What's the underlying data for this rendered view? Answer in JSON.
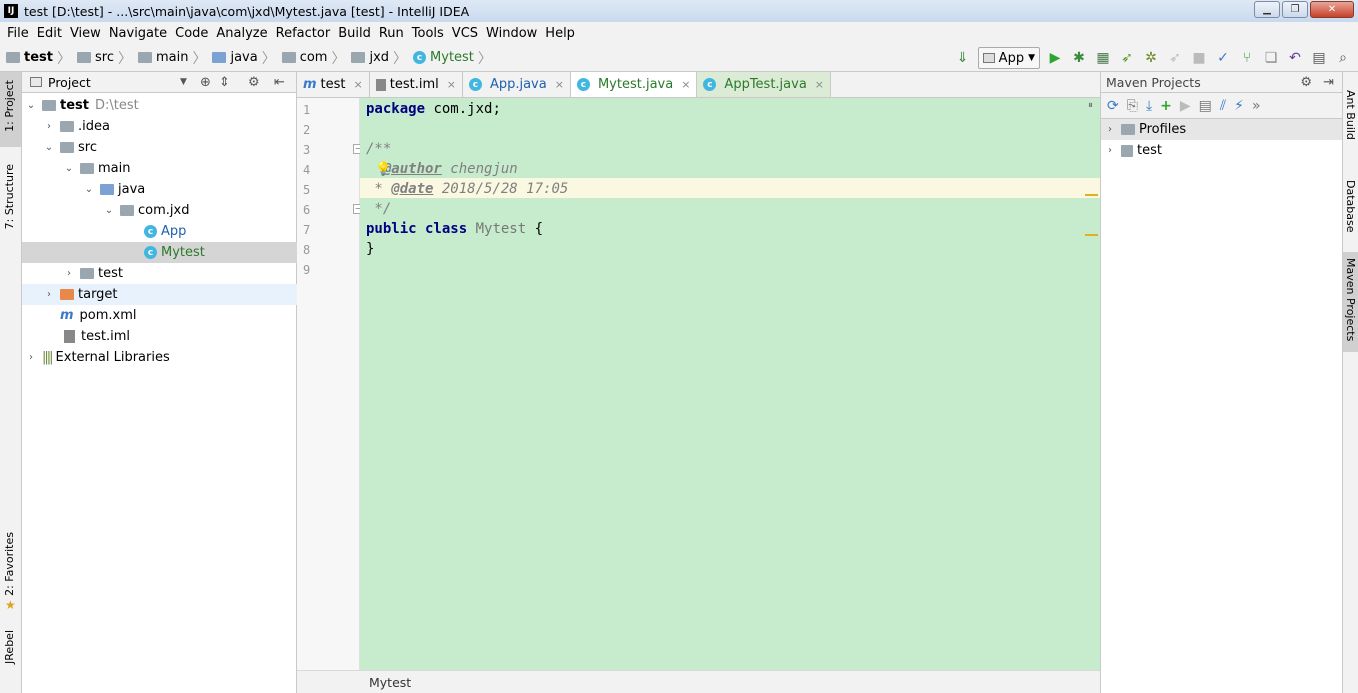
{
  "window": {
    "title": "test [D:\\test] - ...\\src\\main\\java\\com\\jxd\\Mytest.java [test] - IntelliJ IDEA",
    "app_icon": "IJ"
  },
  "menu": [
    "File",
    "Edit",
    "View",
    "Navigate",
    "Code",
    "Analyze",
    "Refactor",
    "Build",
    "Run",
    "Tools",
    "VCS",
    "Window",
    "Help"
  ],
  "breadcrumbs": [
    "test",
    "src",
    "main",
    "java",
    "com",
    "jxd",
    "Mytest"
  ],
  "run_config": "App",
  "left_tabs": {
    "project": "1: Project",
    "structure": "7: Structure",
    "favorites": "2: Favorites",
    "jrebel": "JRebel"
  },
  "right_tabs": {
    "ant": "Ant Build",
    "database": "Database",
    "maven": "Maven Projects"
  },
  "project_panel": {
    "header": "Project",
    "tree": [
      {
        "label": "test",
        "extra": "D:\\test"
      },
      {
        "label": ".idea"
      },
      {
        "label": "src"
      },
      {
        "label": "main"
      },
      {
        "label": "java"
      },
      {
        "label": "com.jxd"
      },
      {
        "label": "App"
      },
      {
        "label": "Mytest"
      },
      {
        "label": "test"
      },
      {
        "label": "target"
      },
      {
        "label": "pom.xml"
      },
      {
        "label": "test.iml"
      },
      {
        "label": "External Libraries"
      }
    ]
  },
  "editor_tabs": [
    {
      "label": "test"
    },
    {
      "label": "test.iml"
    },
    {
      "label": "App.java"
    },
    {
      "label": "Mytest.java"
    },
    {
      "label": "AppTest.java"
    }
  ],
  "code": {
    "line_numbers": [
      "1",
      "2",
      "3",
      "4",
      "5",
      "6",
      "7",
      "8",
      "9"
    ],
    "line1_kw": "package",
    "line1_rest": " com.jxd;",
    "line3": "/**",
    "line4_tag": "@author",
    "line4_rest": " chengjun",
    "line5_star": " * ",
    "line5_tag": "@date",
    "line5_rest": " 2018/5/28 17:05",
    "line6": " */",
    "line7_kw": "public class",
    "line7_cls": " Mytest",
    "line7_rest": " {",
    "line8": "}"
  },
  "status_text": "Mytest",
  "maven_panel": {
    "header": "Maven Projects",
    "items": [
      {
        "label": "Profiles"
      },
      {
        "label": "test"
      }
    ]
  },
  "close_glyph": "×"
}
